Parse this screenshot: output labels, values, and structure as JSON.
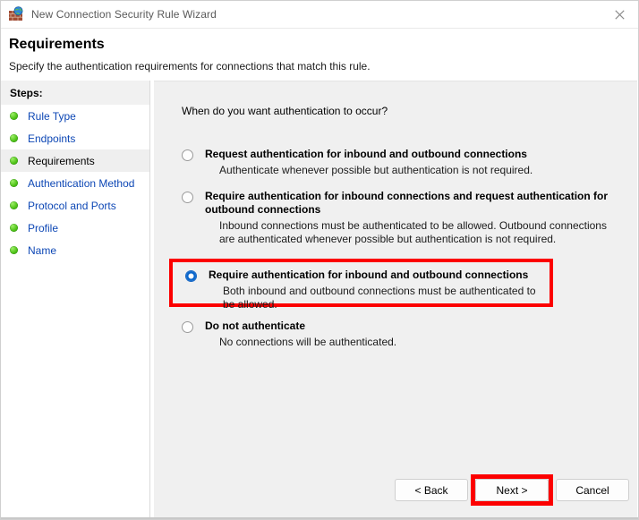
{
  "window": {
    "title": "New Connection Security Rule Wizard",
    "icon": "firewall-globe-icon",
    "close_label": "✕"
  },
  "header": {
    "title": "Requirements",
    "subtitle": "Specify the authentication requirements for connections that match this rule."
  },
  "sidebar": {
    "heading": "Steps:",
    "items": [
      {
        "label": "Rule Type",
        "current": false
      },
      {
        "label": "Endpoints",
        "current": false
      },
      {
        "label": "Requirements",
        "current": true
      },
      {
        "label": "Authentication Method",
        "current": false
      },
      {
        "label": "Protocol and Ports",
        "current": false
      },
      {
        "label": "Profile",
        "current": false
      },
      {
        "label": "Name",
        "current": false
      }
    ]
  },
  "main": {
    "question": "When do you want authentication to occur?",
    "options": [
      {
        "title": "Request authentication for inbound and outbound connections",
        "description": "Authenticate whenever possible but authentication is not required.",
        "selected": false,
        "highlighted": false
      },
      {
        "title": "Require authentication for inbound connections and request authentication for outbound connections",
        "description": "Inbound connections must be authenticated to be allowed. Outbound connections are authenticated whenever possible but authentication is not required.",
        "selected": false,
        "highlighted": false
      },
      {
        "title": "Require authentication for inbound and outbound connections",
        "description": "Both inbound and outbound connections must be authenticated to be allowed.",
        "selected": true,
        "highlighted": true
      },
      {
        "title": "Do not authenticate",
        "description": "No connections will be authenticated.",
        "selected": false,
        "highlighted": false
      }
    ]
  },
  "footer": {
    "back_label": "< Back",
    "next_label": "Next >",
    "cancel_label": "Cancel"
  },
  "colors": {
    "highlight_red": "#fc0000",
    "link_blue": "#0d47b5",
    "radio_blue": "#0a66cc",
    "step_green": "#52c41a",
    "panel_gray": "#f0f0f0"
  }
}
